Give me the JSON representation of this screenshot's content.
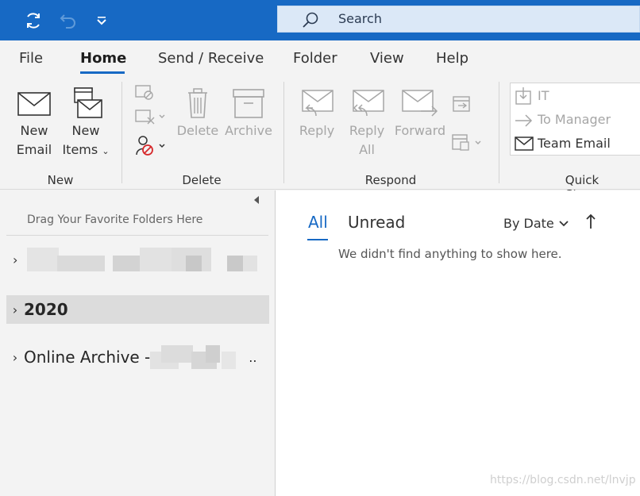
{
  "search": {
    "label": "Search"
  },
  "tabs": [
    "File",
    "Home",
    "Send / Receive",
    "Folder",
    "View",
    "Help"
  ],
  "ribbon": {
    "new_group": {
      "new_email": [
        "New",
        "Email"
      ],
      "new_items": [
        "New",
        "Items"
      ],
      "label": "New"
    },
    "delete_group": {
      "delete": "Delete",
      "archive": "Archive",
      "label": "Delete"
    },
    "respond_group": {
      "reply": "Reply",
      "reply_all": [
        "Reply",
        "All"
      ],
      "forward": "Forward",
      "label": "Respond"
    },
    "quick_steps": {
      "items": [
        "IT",
        "To Manager",
        "Team Email"
      ],
      "label": "Quick Steps"
    }
  },
  "folders": {
    "favorites_hint": "Drag Your Favorite Folders Here",
    "items": [
      "2020",
      "Online Archive - ",
      ".."
    ]
  },
  "message_list": {
    "filter_all": "All",
    "filter_unread": "Unread",
    "sort_label": "By Date",
    "empty_text": "We didn't find anything to show here."
  },
  "watermark": "https://blog.csdn.net/lnvjp",
  "colors": {
    "accent": "#1769c4",
    "title_bar": "#1769c4"
  }
}
